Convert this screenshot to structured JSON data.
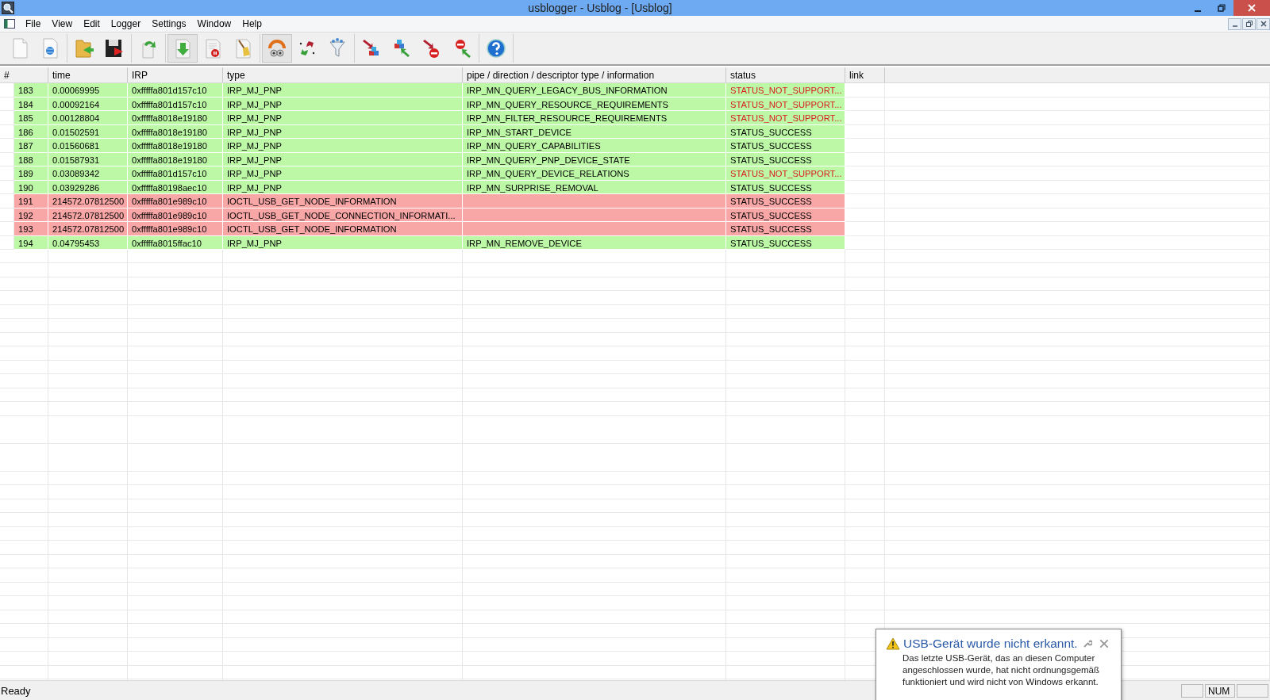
{
  "window": {
    "title": "usblogger - Usblog - [Usblog]"
  },
  "menu": [
    "File",
    "View",
    "Edit",
    "Logger",
    "Settings",
    "Window",
    "Help"
  ],
  "toolbar": [
    [
      {
        "pressed": false
      },
      {
        "pressed": false
      }
    ],
    [
      {
        "pressed": false
      },
      {
        "pressed": false
      }
    ],
    [
      {
        "pressed": false
      }
    ],
    [
      {
        "pressed": true
      },
      {
        "pressed": false
      },
      {
        "pressed": false
      }
    ],
    [
      {
        "pressed": true
      },
      {
        "pressed": false
      },
      {
        "pressed": false
      }
    ],
    [
      {
        "pressed": false
      },
      {
        "pressed": false
      },
      {
        "pressed": false
      },
      {
        "pressed": false
      }
    ],
    [
      {
        "pressed": false
      }
    ]
  ],
  "table": {
    "columns": [
      "#",
      "time",
      "IRP",
      "type",
      "pipe / direction / descriptor type / information",
      "status",
      "link"
    ],
    "rows": [
      {
        "cells": [
          "183",
          "0.00069995",
          "0xfffffa801d157c10",
          "IRP_MJ_PNP",
          "IRP_MN_QUERY_LEGACY_BUS_INFORMATION",
          "STATUS_NOT_SUPPORT..."
        ],
        "color": "#bcf8a6",
        "failed": true
      },
      {
        "cells": [
          "184",
          "0.00092164",
          "0xfffffa801d157c10",
          "IRP_MJ_PNP",
          "IRP_MN_QUERY_RESOURCE_REQUIREMENTS",
          "STATUS_NOT_SUPPORT..."
        ],
        "color": "#bcf8a6",
        "failed": true
      },
      {
        "cells": [
          "185",
          "0.00128804",
          "0xfffffa8018e19180",
          "IRP_MJ_PNP",
          "IRP_MN_FILTER_RESOURCE_REQUIREMENTS",
          "STATUS_NOT_SUPPORT..."
        ],
        "color": "#bcf8a6",
        "failed": true
      },
      {
        "cells": [
          "186",
          "0.01502591",
          "0xfffffa8018e19180",
          "IRP_MJ_PNP",
          "IRP_MN_START_DEVICE",
          "STATUS_SUCCESS"
        ],
        "color": "#bcf8a6",
        "failed": false
      },
      {
        "cells": [
          "187",
          "0.01560681",
          "0xfffffa8018e19180",
          "IRP_MJ_PNP",
          "IRP_MN_QUERY_CAPABILITIES",
          "STATUS_SUCCESS"
        ],
        "color": "#bcf8a6",
        "failed": false
      },
      {
        "cells": [
          "188",
          "0.01587931",
          "0xfffffa8018e19180",
          "IRP_MJ_PNP",
          "IRP_MN_QUERY_PNP_DEVICE_STATE",
          "STATUS_SUCCESS"
        ],
        "color": "#bcf8a6",
        "failed": false
      },
      {
        "cells": [
          "189",
          "0.03089342",
          "0xfffffa801d157c10",
          "IRP_MJ_PNP",
          "IRP_MN_QUERY_DEVICE_RELATIONS",
          "STATUS_NOT_SUPPORT..."
        ],
        "color": "#bcf8a6",
        "failed": true
      },
      {
        "cells": [
          "190",
          "0.03929286",
          "0xfffffa80198aec10",
          "IRP_MJ_PNP",
          "IRP_MN_SURPRISE_REMOVAL",
          "STATUS_SUCCESS"
        ],
        "color": "#bcf8a6",
        "failed": false
      },
      {
        "cells": [
          "191",
          "214572.07812500",
          "0xfffffa801e989c10",
          "IOCTL_USB_GET_NODE_INFORMATION",
          "",
          "STATUS_SUCCESS"
        ],
        "color": "#f8a6a6",
        "failed": false
      },
      {
        "cells": [
          "192",
          "214572.07812500",
          "0xfffffa801e989c10",
          "IOCTL_USB_GET_NODE_CONNECTION_INFORMATI...",
          "",
          "STATUS_SUCCESS"
        ],
        "color": "#f8a6a6",
        "failed": false
      },
      {
        "cells": [
          "193",
          "214572.07812500",
          "0xfffffa801e989c10",
          "IOCTL_USB_GET_NODE_INFORMATION",
          "",
          "STATUS_SUCCESS"
        ],
        "color": "#f8a6a6",
        "failed": false
      },
      {
        "cells": [
          "194",
          "0.04795453",
          "0xfffffa8015ffac10",
          "IRP_MJ_PNP",
          "IRP_MN_REMOVE_DEVICE",
          "STATUS_SUCCESS"
        ],
        "color": "#bcf8a6",
        "failed": false
      }
    ]
  },
  "notification": {
    "title": "USB-Gerät wurde nicht erkannt.",
    "body": "Das letzte USB-Gerät, das an diesen Computer angeschlossen wurde, hat nicht ordnungsgemäß funktioniert und wird nicht von Windows erkannt."
  },
  "status_bar": {
    "message": "Ready",
    "panes": [
      "NUM"
    ]
  }
}
